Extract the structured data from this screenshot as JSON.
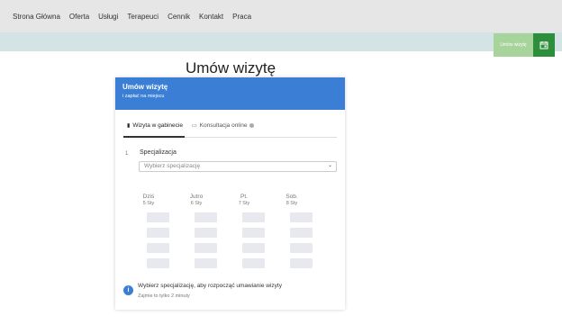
{
  "nav": {
    "items": [
      {
        "label": "Strona Główna"
      },
      {
        "label": "Oferta"
      },
      {
        "label": "Usługi"
      },
      {
        "label": "Terapeuci"
      },
      {
        "label": "Cennik"
      },
      {
        "label": "Kontakt"
      },
      {
        "label": "Praca"
      }
    ]
  },
  "cta": {
    "label": "Umów wizytę",
    "icon": "calendar-icon"
  },
  "page_title": "Umów wizytę",
  "card": {
    "header_title": "Umów wizytę",
    "header_subtitle": "i zapłać na miejscu",
    "tabs": [
      {
        "label": "Wizyta w gabinecie",
        "icon": "bookmark-icon",
        "active": true
      },
      {
        "label": "Konsultacja online",
        "icon": "video-icon",
        "active": false
      }
    ],
    "step_number": "1",
    "spec_label": "Specjalizacja",
    "spec_placeholder": "Wybierz specjalizację",
    "days": [
      {
        "name": "Dziś",
        "date": "5 Sty"
      },
      {
        "name": "Jutro",
        "date": "6 Sty"
      },
      {
        "name": "Pt.",
        "date": "7 Sty"
      },
      {
        "name": "Sob.",
        "date": "8 Sty"
      }
    ],
    "info_text": "Wybierz specjalizację, aby rozpocząć umawianie wizyty",
    "info_sub": "Zajmie to tylko 2 minuty"
  },
  "colors": {
    "header_blue": "#3a7fd5",
    "cta_green_light": "#a7d49b",
    "cta_green_dark": "#2d8f3c",
    "nav_bg": "#e6e6e6",
    "teal_bar": "#d4e3e3"
  }
}
